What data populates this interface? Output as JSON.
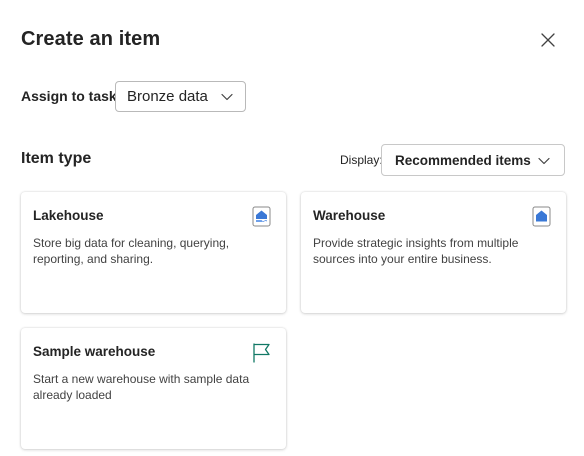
{
  "dialog": {
    "title": "Create an item",
    "close_icon": "close-icon"
  },
  "assign": {
    "label": "Assign to task",
    "selected": "Bronze data"
  },
  "item_type": {
    "title": "Item type",
    "display_label": "Display:",
    "display_selected": "Recommended items"
  },
  "cards": [
    {
      "title": "Lakehouse",
      "description": "Store big data for cleaning, querying, reporting, and sharing.",
      "icon": "lakehouse-icon"
    },
    {
      "title": "Warehouse",
      "description": "Provide strategic insights from multiple sources into your entire business.",
      "icon": "warehouse-icon"
    },
    {
      "title": "Sample warehouse",
      "description": "Start a new warehouse with sample data already loaded",
      "icon": "flag-icon"
    }
  ],
  "colors": {
    "accent_blue": "#3a78d6",
    "flag_green": "#117865",
    "text": "#242424"
  }
}
